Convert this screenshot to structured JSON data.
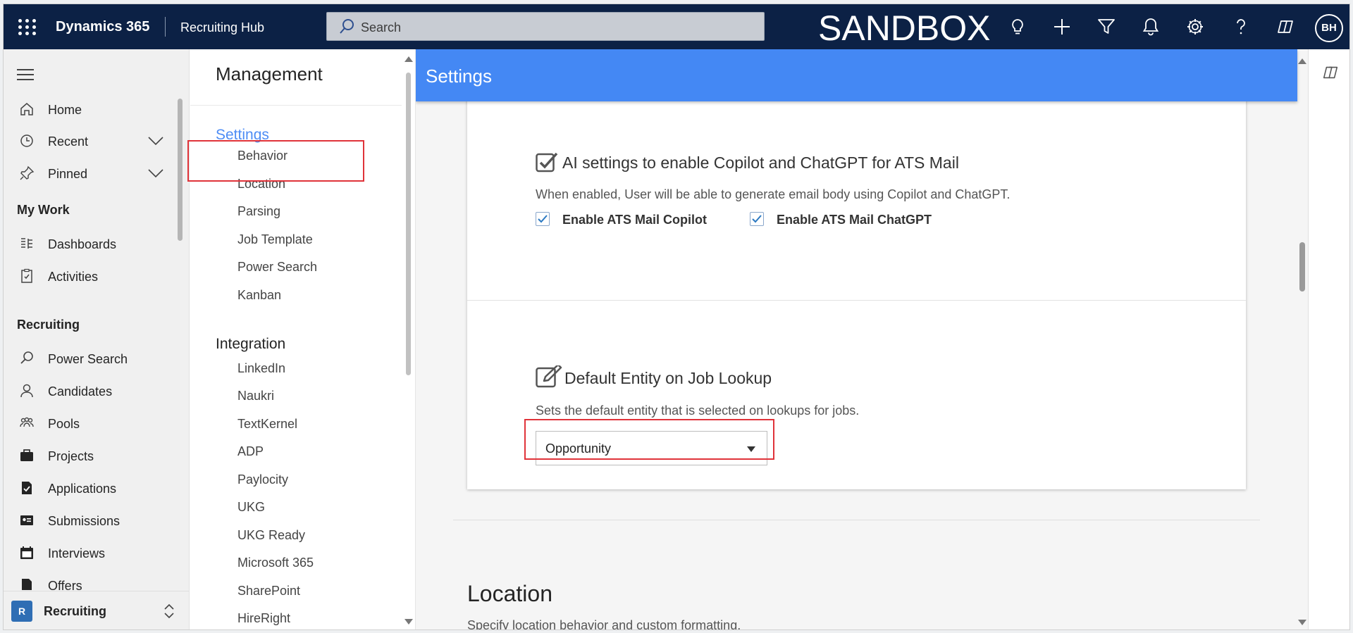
{
  "topbar": {
    "brand": "Dynamics 365",
    "app_name": "Recruiting Hub",
    "search_placeholder": "Search",
    "environment_label": "SANDBOX",
    "avatar_initials": "BH",
    "icons": [
      "lightbulb-icon",
      "plus-icon",
      "filter-icon",
      "bell-icon",
      "gear-icon",
      "help-icon",
      "copilot-icon"
    ],
    "bg_color": "#0c2145"
  },
  "leftnav": {
    "items": [
      {
        "label": "Home",
        "icon": "home-icon"
      },
      {
        "label": "Recent",
        "icon": "clock-icon",
        "expandable": true
      },
      {
        "label": "Pinned",
        "icon": "pin-icon",
        "expandable": true
      }
    ],
    "my_work_heading": "My Work",
    "my_work": [
      {
        "label": "Dashboards",
        "icon": "dashboard-icon"
      },
      {
        "label": "Activities",
        "icon": "activities-icon"
      }
    ],
    "recruiting_heading": "Recruiting",
    "recruiting": [
      {
        "label": "Power Search",
        "icon": "search-icon"
      },
      {
        "label": "Candidates",
        "icon": "person-icon"
      },
      {
        "label": "Pools",
        "icon": "people-icon"
      },
      {
        "label": "Projects",
        "icon": "briefcase-icon"
      },
      {
        "label": "Applications",
        "icon": "document-check-icon"
      },
      {
        "label": "Submissions",
        "icon": "id-card-icon"
      },
      {
        "label": "Interviews",
        "icon": "calendar-icon"
      },
      {
        "label": "Offers",
        "icon": "offer-icon"
      }
    ],
    "area": {
      "badge": "R",
      "label": "Recruiting"
    }
  },
  "management": {
    "title": "Management",
    "settings_group": "Settings",
    "settings_items": [
      "Behavior",
      "Location",
      "Parsing",
      "Job Template",
      "Power Search",
      "Kanban"
    ],
    "integration_group": "Integration",
    "integration_items": [
      "LinkedIn",
      "Naukri",
      "TextKernel",
      "ADP",
      "Paylocity",
      "UKG",
      "UKG Ready",
      "Microsoft 365",
      "SharePoint",
      "HireRight"
    ]
  },
  "main": {
    "header": "Settings",
    "ai_section": {
      "title": "AI settings to enable Copilot and ChatGPT for ATS Mail",
      "description": "When enabled, User will be able to generate email body using Copilot and ChatGPT.",
      "copilot_label": "Enable ATS Mail Copilot",
      "copilot_checked": true,
      "chatgpt_label": "Enable ATS Mail ChatGPT",
      "chatgpt_checked": true
    },
    "job_lookup": {
      "title": "Default Entity on Job Lookup",
      "description": "Sets the default entity that is selected on lookups for jobs.",
      "selected_value": "Opportunity"
    },
    "location": {
      "title": "Location",
      "description": "Specify location behavior and custom formatting."
    },
    "accent_color": "#4488f4"
  }
}
